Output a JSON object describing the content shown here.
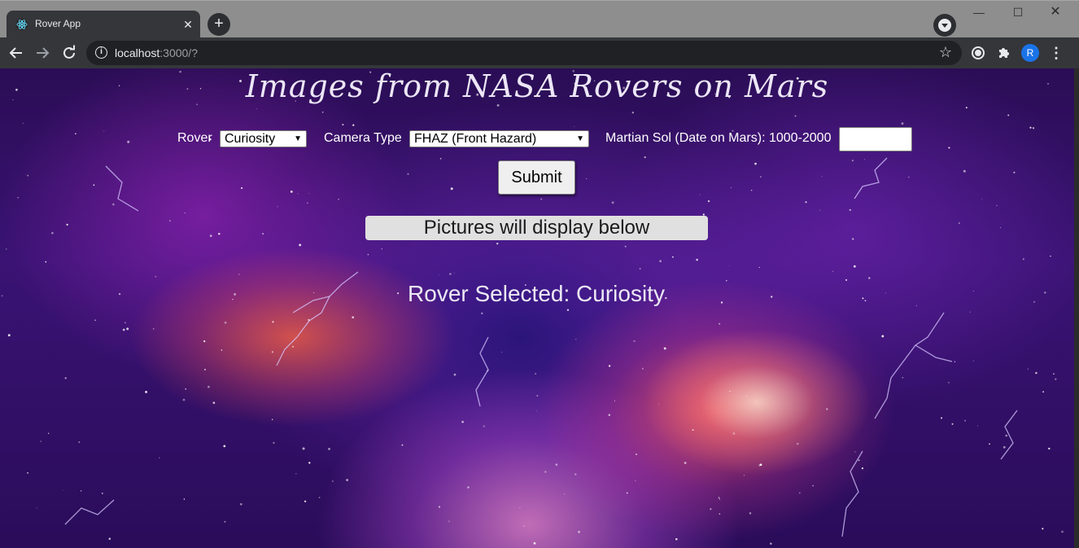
{
  "browser": {
    "tab_title": "Rover App",
    "tab_close": "✕",
    "new_tab": "+",
    "url_host": "localhost",
    "url_rest": ":3000/?",
    "avatar_initial": "R"
  },
  "page": {
    "title": "Images from NASA Rovers on Mars",
    "form": {
      "rover_label": "Rover",
      "rover_value": "Curiosity",
      "camera_label": "Camera Type",
      "camera_value": "FHAZ (Front Hazard)",
      "sol_label": "Martian Sol (Date on Mars): 1000-2000",
      "sol_value": ""
    },
    "submit_label": "Submit",
    "banner_text": "Pictures will display below",
    "rover_selected_prefix": "Rover Selected: ",
    "rover_selected_value": "Curiosity"
  },
  "icons": {
    "back": "back-arrow-icon",
    "forward": "forward-arrow-icon",
    "reload": "reload-icon",
    "info": "info-icon",
    "star": "bookmark-star-icon",
    "extensions": "puzzle-icon",
    "menu": "more-vert-icon"
  },
  "colors": {
    "chrome_dark": "#35363a",
    "tabstrip": "#8e8e8e",
    "avatar": "#1a73e8",
    "banner_bg": "#e0e0e0"
  }
}
